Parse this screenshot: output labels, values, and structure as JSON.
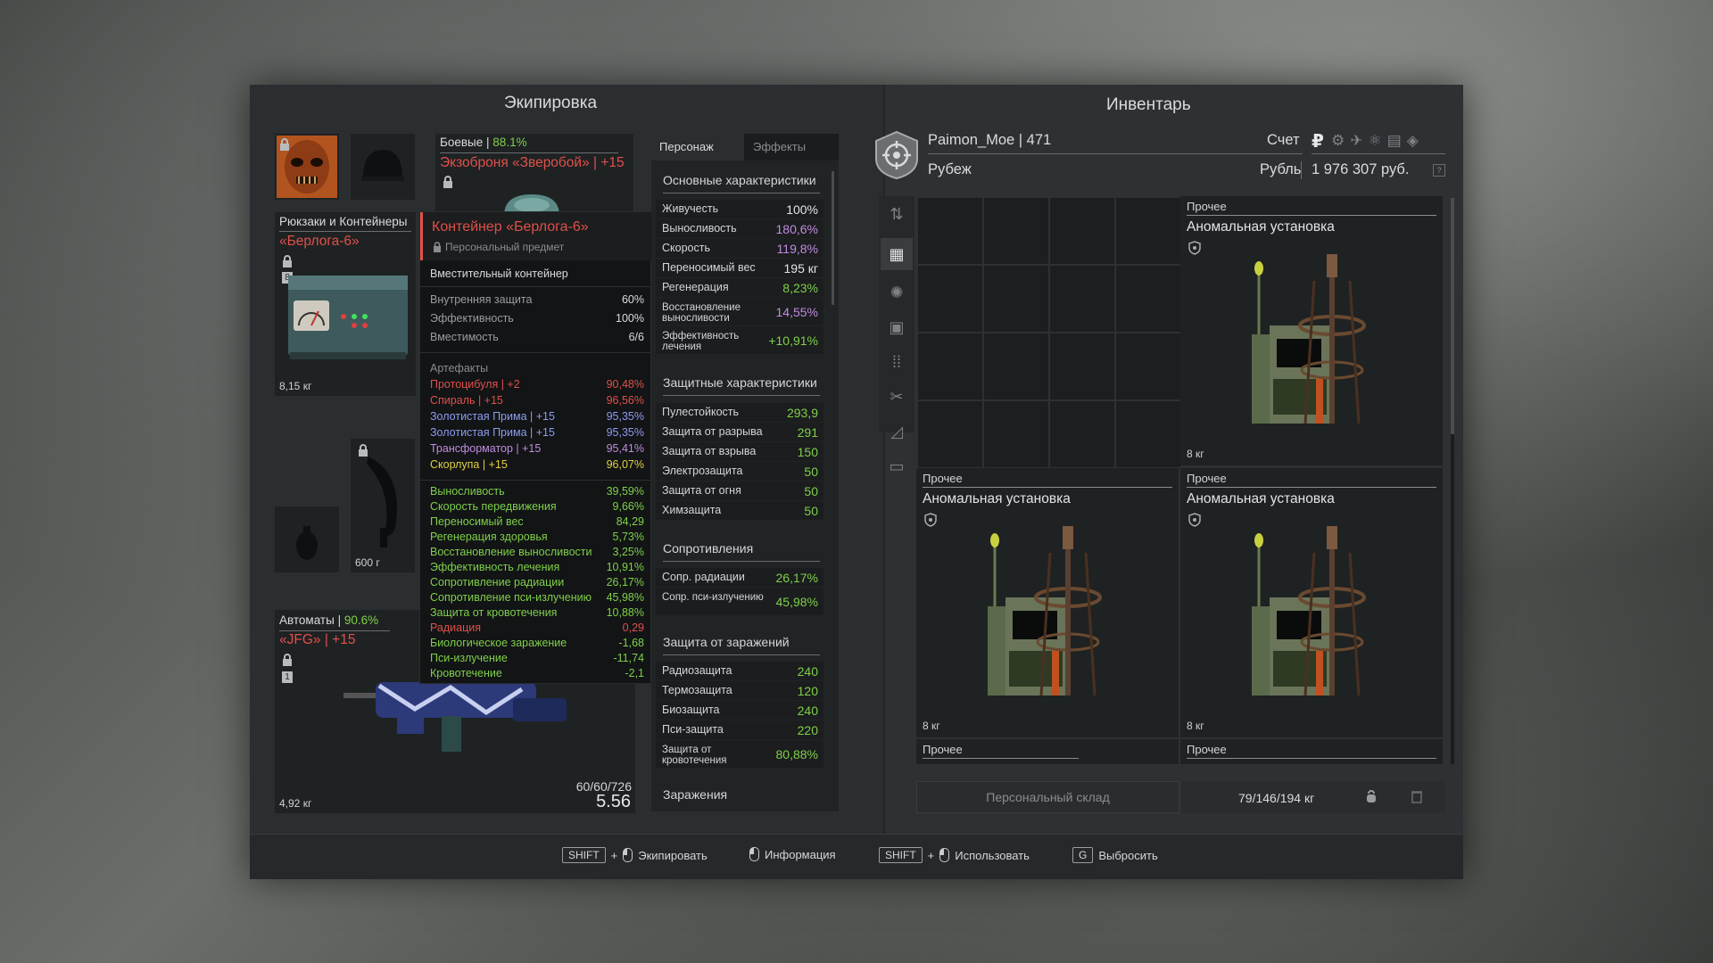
{
  "equipment": {
    "title": "Экипировка",
    "armor": {
      "category": "Боевые",
      "durability": "88.1%",
      "name": "Экзоброня «Зверобой» | +15"
    },
    "backpack": {
      "category": "Рюкзаки и Контейнеры",
      "name": "«Берлога-6»",
      "slot_num": "8",
      "weight": "8,15 кг"
    },
    "melee": {
      "weight": "600 г"
    },
    "rifle": {
      "category": "Автоматы",
      "durability": "90.6%",
      "name": "«JFG» | +15",
      "slot_num": "1",
      "ammo": "60/60/726",
      "caliber": "5.56",
      "weight": "4,92 кг"
    }
  },
  "tooltip": {
    "title": "Контейнер «Берлога-6»",
    "subtitle": "Персональный предмет",
    "type": "Вместительный контейнер",
    "props": [
      {
        "name": "Внутренняя защита",
        "value": "60%"
      },
      {
        "name": "Эффективность",
        "value": "100%"
      },
      {
        "name": "Вместимость",
        "value": "6/6"
      }
    ],
    "artifacts_header": "Артефакты",
    "artifacts": [
      {
        "name": "Протоцибуля | +2",
        "value": "90,48%",
        "color": "#e0504a"
      },
      {
        "name": "Спираль | +15",
        "value": "96,56%",
        "color": "#e0504a"
      },
      {
        "name": "Золотистая Прима | +15",
        "value": "95,35%",
        "color": "#8c9cf0"
      },
      {
        "name": "Золотистая Прима | +15",
        "value": "95,35%",
        "color": "#8c9cf0"
      },
      {
        "name": "Трансформатор | +15",
        "value": "95,41%",
        "color": "#c08ce0"
      },
      {
        "name": "Скорлупа | +15",
        "value": "96,07%",
        "color": "#e0d040"
      }
    ],
    "bonuses": [
      {
        "name": "Выносливость",
        "value": "39,59%",
        "color": "#7fd04a"
      },
      {
        "name": "Скорость передвижения",
        "value": "9,66%",
        "color": "#7fd04a"
      },
      {
        "name": "Переносимый вес",
        "value": "84,29",
        "color": "#7fd04a"
      },
      {
        "name": "Регенерация здоровья",
        "value": "5,73%",
        "color": "#7fd04a"
      },
      {
        "name": "Восстановление выносливости",
        "value": "3,25%",
        "color": "#7fd04a"
      },
      {
        "name": "Эффективность лечения",
        "value": "10,91%",
        "color": "#7fd04a"
      },
      {
        "name": "Сопротивление радиации",
        "value": "26,17%",
        "color": "#7fd04a"
      },
      {
        "name": "Сопротивление пси-излучению",
        "value": "45,98%",
        "color": "#7fd04a"
      },
      {
        "name": "Защита от кровотечения",
        "value": "10,88%",
        "color": "#7fd04a"
      },
      {
        "name": "Радиация",
        "value": "0,29",
        "color": "#e0504a"
      },
      {
        "name": "Биологическое заражение",
        "value": "-1,68",
        "color": "#7fd04a"
      },
      {
        "name": "Пси-излучение",
        "value": "-11,74",
        "color": "#7fd04a"
      },
      {
        "name": "Кровотечение",
        "value": "-2,1",
        "color": "#7fd04a"
      }
    ]
  },
  "stats": {
    "tab_character": "Персонаж",
    "tab_effects": "Эффекты",
    "main_header": "Основные характеристики",
    "main": [
      {
        "name": "Живучесть",
        "value": "100%",
        "color": "#e2e4e5"
      },
      {
        "name": "Выносливость",
        "value": "180,6%",
        "color": "#c08ce0"
      },
      {
        "name": "Скорость",
        "value": "119,8%",
        "color": "#c08ce0"
      },
      {
        "name": "Переносимый вес",
        "value": "195 кг",
        "color": "#e2e4e5"
      },
      {
        "name": "Регенерация",
        "value": "8,23%",
        "color": "#7fd04a"
      },
      {
        "name": "Восстановление выносливости",
        "value": "14,55%",
        "color": "#c08ce0"
      },
      {
        "name": "Эффективность лечения",
        "value": "+10,91%",
        "color": "#7fd04a"
      }
    ],
    "defense_header": "Защитные характеристики",
    "defense": [
      {
        "name": "Пулестойкость",
        "value": "293,9"
      },
      {
        "name": "Защита от разрыва",
        "value": "291"
      },
      {
        "name": "Защита от взрыва",
        "value": "150"
      },
      {
        "name": "Электрозащита",
        "value": "50"
      },
      {
        "name": "Защита от огня",
        "value": "50"
      },
      {
        "name": "Химзащита",
        "value": "50"
      }
    ],
    "resist_header": "Сопротивления",
    "resist": [
      {
        "name": "Сопр. радиации",
        "value": "26,17%"
      },
      {
        "name": "Сопр. пси-излучению",
        "value": "45,98%"
      }
    ],
    "infect_header": "Защита от заражений",
    "infect": [
      {
        "name": "Радиозащита",
        "value": "240"
      },
      {
        "name": "Термозащита",
        "value": "120"
      },
      {
        "name": "Биозащита",
        "value": "240"
      },
      {
        "name": "Пси-защита",
        "value": "220"
      },
      {
        "name": "Защита от кровотечения",
        "value": "80,88%"
      }
    ],
    "infections_header": "Заражения"
  },
  "inventory": {
    "title": "Инвентарь",
    "player": "Paimon_Moe | 471",
    "faction": "Рубеж",
    "account_label": "Счет",
    "currency_symbol": "₽",
    "currency_name": "Рубль",
    "balance": "1 976 307 руб.",
    "items": [
      {
        "category": "Прочее",
        "name": "Аномальная установка",
        "weight": "8 кг"
      },
      {
        "category": "Прочее",
        "name": "Аномальная установка",
        "weight": "8 кг"
      },
      {
        "category": "Прочее",
        "name": "Аномальная установка",
        "weight": "8 кг"
      },
      {
        "category": "Прочее"
      },
      {
        "category": "Прочее"
      }
    ],
    "storage_button": "Персональный склад",
    "weight": "79/146/194 кг"
  },
  "hints": {
    "equip_key": "SHIFT",
    "equip_plus": "+",
    "equip": "Экипировать",
    "info": "Информация",
    "use_key": "SHIFT",
    "use_plus": "+",
    "use": "Использовать",
    "drop_key": "G",
    "drop": "Выбросить"
  }
}
